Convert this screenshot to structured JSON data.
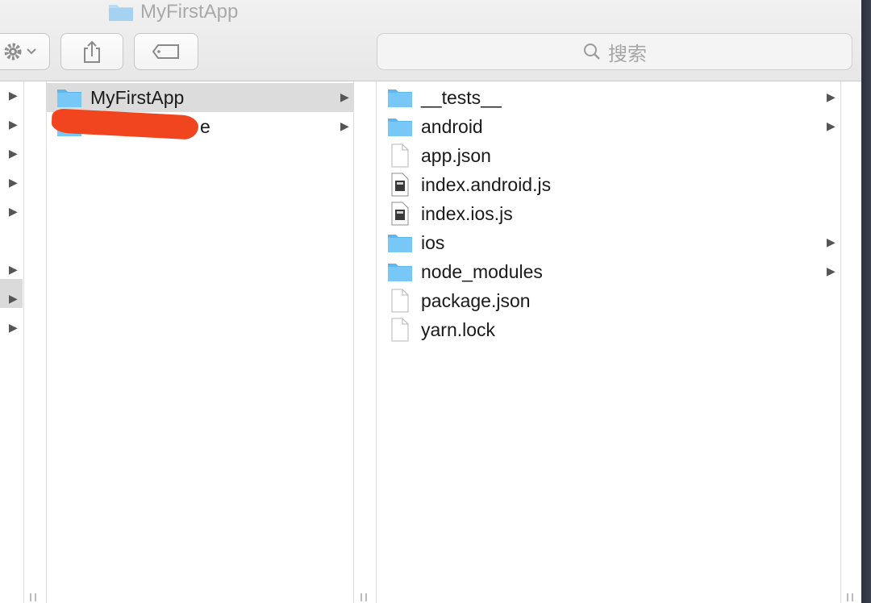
{
  "window": {
    "title": "MyFirstApp"
  },
  "search": {
    "placeholder": "搜索"
  },
  "column1": {
    "items": [
      {
        "label": "MyFirstApp",
        "kind": "folder",
        "selected": true
      },
      {
        "label": "e",
        "kind": "folder",
        "selected": false
      }
    ]
  },
  "column2": {
    "items": [
      {
        "label": "__tests__",
        "kind": "folder"
      },
      {
        "label": "android",
        "kind": "folder"
      },
      {
        "label": "app.json",
        "kind": "file"
      },
      {
        "label": "index.android.js",
        "kind": "executable"
      },
      {
        "label": "index.ios.js",
        "kind": "executable"
      },
      {
        "label": "ios",
        "kind": "folder"
      },
      {
        "label": "node_modules",
        "kind": "folder"
      },
      {
        "label": "package.json",
        "kind": "file"
      },
      {
        "label": "yarn.lock",
        "kind": "file"
      }
    ]
  },
  "colors": {
    "folder": "#6cc2f4",
    "selection": "#dcdcdc",
    "redaction": "#f0451f"
  }
}
